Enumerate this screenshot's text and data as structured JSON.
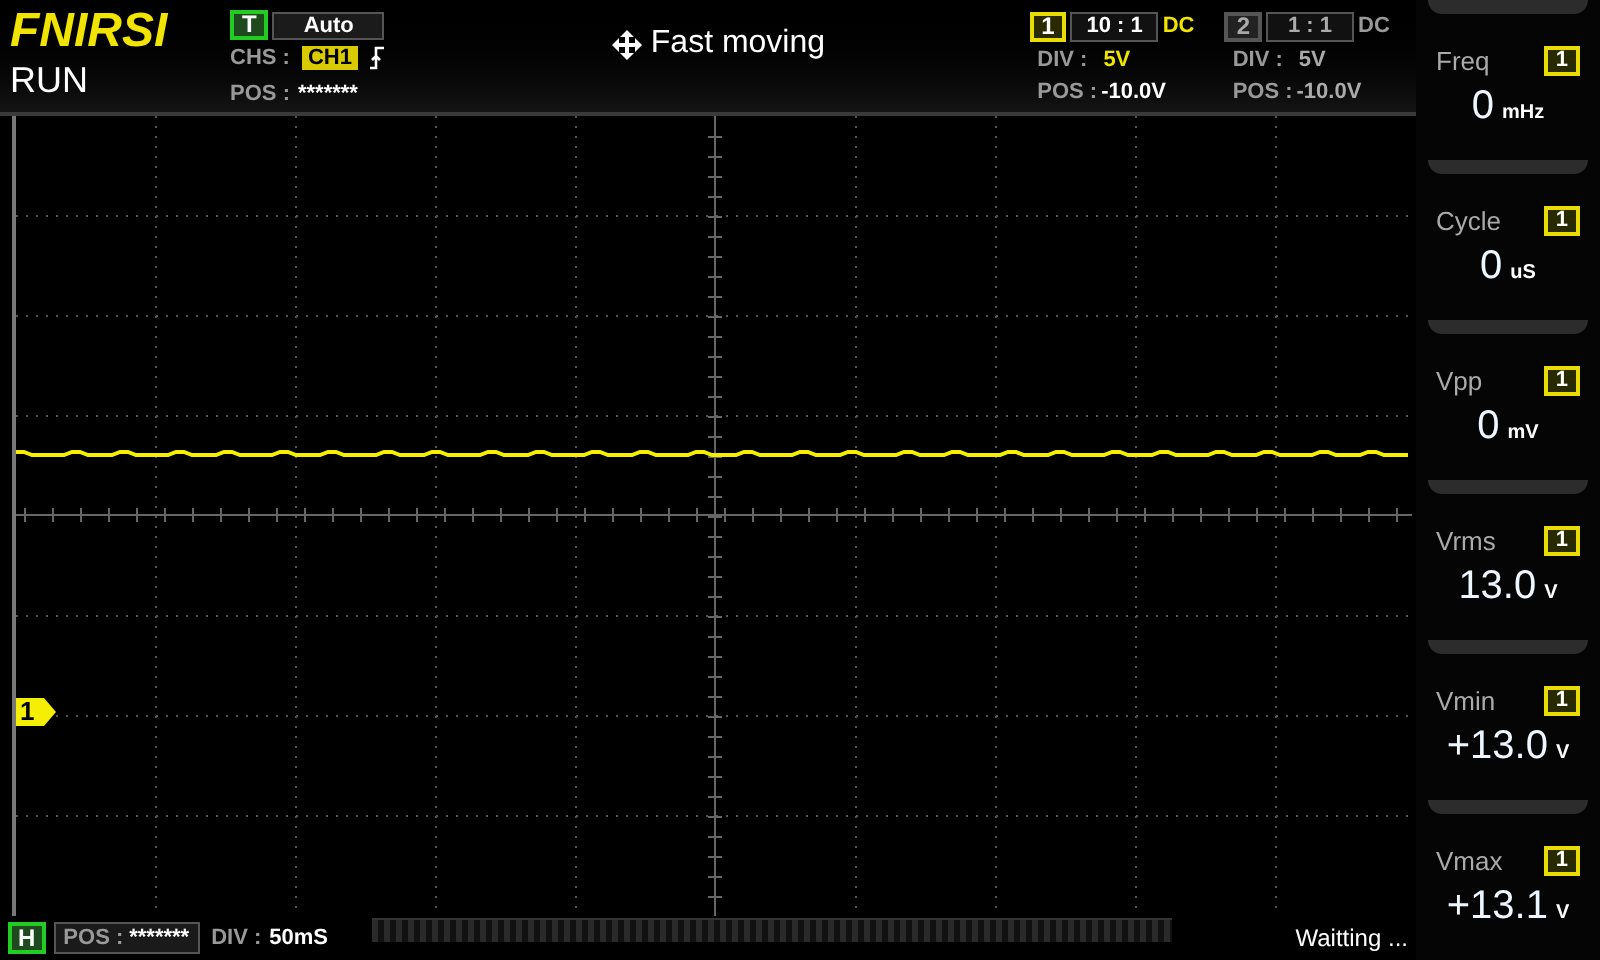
{
  "brand": "FNIRSI",
  "run_state": "RUN",
  "trigger": {
    "badge": "T",
    "mode": "Auto",
    "chs_label": "CHS :",
    "channel": "CH1",
    "pos_label": "POS :",
    "pos_value": "*******"
  },
  "title": "Fast moving",
  "channels": [
    {
      "number": "1",
      "probe": "10 : 1",
      "coupling": "DC",
      "div_label": "DIV :",
      "div": "5V",
      "pos_label": "POS :",
      "pos": "-10.0V",
      "active": true
    },
    {
      "number": "2",
      "probe": "1 : 1",
      "coupling": "DC",
      "div_label": "DIV :",
      "div": "5V",
      "pos_label": "POS :",
      "pos": "-10.0V",
      "active": false
    }
  ],
  "channel_marker": "1",
  "measurements": [
    {
      "label": "Freq",
      "channel": "1",
      "value": "0",
      "unit": "mHz"
    },
    {
      "label": "Cycle",
      "channel": "1",
      "value": "0",
      "unit": "uS"
    },
    {
      "label": "Vpp",
      "channel": "1",
      "value": "0",
      "unit": "mV"
    },
    {
      "label": "Vrms",
      "channel": "1",
      "value": "13.0",
      "unit": "V"
    },
    {
      "label": "Vmin",
      "channel": "1",
      "value": "+13.0",
      "unit": "V"
    },
    {
      "label": "Vmax",
      "channel": "1",
      "value": "+13.1",
      "unit": "V"
    }
  ],
  "timebase": {
    "badge": "H",
    "pos_label": "POS :",
    "pos_value": "*******",
    "div_label": "DIV :",
    "div": "50mS"
  },
  "status": "Waitting ..."
}
